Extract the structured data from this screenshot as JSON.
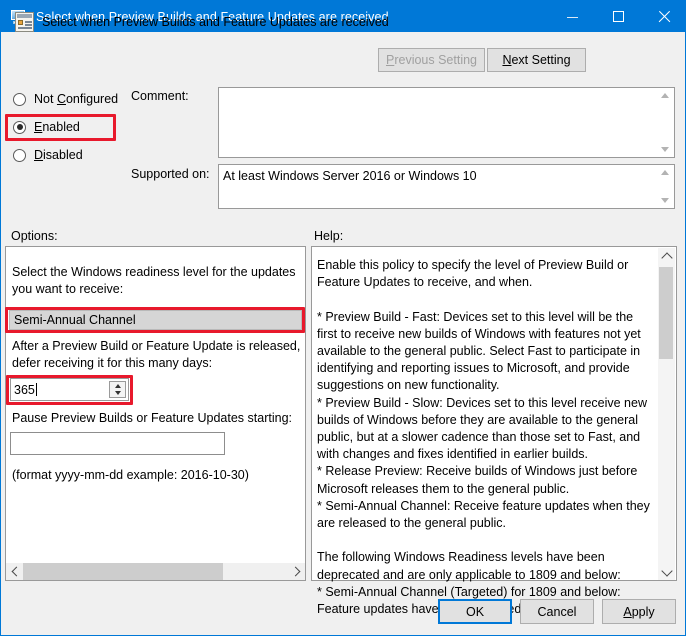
{
  "window": {
    "title": "Select when Preview Builds and Feature Updates are received",
    "icon": "policy-monitor-icon",
    "minimize_label": "Minimize",
    "maximize_label": "Maximize",
    "close_label": "Close",
    "accent_color": "#0078d7",
    "highlight_color": "#e8192c"
  },
  "header": {
    "title": "Select when Preview Builds and Feature Updates are received",
    "icon": "group-policy-setting-icon",
    "previous_setting": "Previous Setting",
    "previous_setting_prefix": "P",
    "previous_setting_rest": "revious Setting",
    "next_setting": "Next Setting",
    "next_setting_prefix": "N",
    "next_setting_rest": "ext Setting"
  },
  "states": {
    "not_configured": {
      "label": "Not Configured",
      "pre": "Not ",
      "accel": "C",
      "post": "onfigured",
      "selected": false
    },
    "enabled": {
      "label": "Enabled",
      "pre": "",
      "accel": "E",
      "post": "nabled",
      "selected": true,
      "highlighted": true
    },
    "disabled": {
      "label": "Disabled",
      "pre": "",
      "accel": "D",
      "post": "isabled",
      "selected": false
    }
  },
  "comment": {
    "label": "Comment:",
    "value": "",
    "placeholder": ""
  },
  "supported_on": {
    "label": "Supported on:",
    "value": "At least Windows Server 2016 or Windows 10"
  },
  "options": {
    "label": "Options:",
    "readiness_prompt": "Select the Windows readiness level for the updates you want to receive:",
    "readiness_value": "Semi-Annual Channel",
    "readiness_highlighted": true,
    "defer_prompt": "After a Preview Build or Feature Update is released, defer receiving it for this many days:",
    "defer_days": "365",
    "defer_highlighted": true,
    "pause_prompt": "Pause Preview Builds or Feature Updates starting:",
    "pause_date": "",
    "format_hint": "(format yyyy-mm-dd example: 2016-10-30)",
    "scroll_left": "Scroll left",
    "scroll_right": "Scroll right"
  },
  "help": {
    "label": "Help:",
    "text": "Enable this policy to specify the level of Preview Build or Feature Updates to receive, and when.\n\n* Preview Build - Fast: Devices set to this level will be the first to receive new builds of Windows with features not yet available to the general public. Select Fast to participate in identifying and reporting issues to Microsoft, and provide suggestions on new functionality.\n* Preview Build - Slow: Devices set to this level receive new builds of Windows before they are available to the general public, but at a slower cadence than those set to Fast, and with changes and fixes identified in earlier builds.\n* Release Preview: Receive builds of Windows just before Microsoft releases them to the general public.\n* Semi-Annual Channel: Receive feature updates when they are released to the general public.\n\nThe following Windows Readiness levels have been deprecated and are only applicable to 1809 and below:\n* Semi-Annual Channel (Targeted) for 1809 and below: Feature updates have been released.",
    "scroll_up": "Scroll up",
    "scroll_down": "Scroll down"
  },
  "footer": {
    "ok": "OK",
    "cancel": "Cancel",
    "apply": "Apply",
    "apply_prefix": "A",
    "apply_rest": "pply"
  }
}
